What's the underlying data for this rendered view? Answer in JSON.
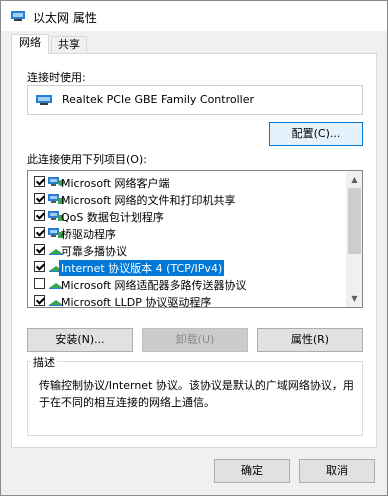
{
  "window": {
    "title": "以太网 属性"
  },
  "tabs": [
    {
      "label": "网络"
    },
    {
      "label": "共享"
    }
  ],
  "connect_using": {
    "label": "连接时使用:",
    "adapter": "Realtek PCIe GBE Family Controller",
    "configure_button": "配置(C)..."
  },
  "items_section": {
    "label": "此连接使用下列项目(O):",
    "items": [
      {
        "label": "Microsoft 网络客户端",
        "checked": true,
        "icon": "network-client-icon"
      },
      {
        "label": "Microsoft 网络的文件和打印机共享",
        "checked": true,
        "icon": "network-service-icon"
      },
      {
        "label": "QoS 数据包计划程序",
        "checked": true,
        "icon": "network-service-icon"
      },
      {
        "label": "桥驱动程序",
        "checked": true,
        "icon": "protocol-icon"
      },
      {
        "label": "可靠多播协议",
        "checked": true,
        "icon": "protocol-icon"
      },
      {
        "label": "Internet 协议版本 4 (TCP/IPv4)",
        "checked": true,
        "icon": "protocol-icon",
        "selected": true
      },
      {
        "label": "Microsoft 网络适配器多路传送器协议",
        "checked": false,
        "icon": "protocol-icon"
      },
      {
        "label": "Microsoft LLDP 协议驱动程序",
        "checked": true,
        "icon": "protocol-icon"
      }
    ],
    "install_button": "安装(N)...",
    "uninstall_button": "卸载(U)",
    "properties_button": "属性(R)"
  },
  "description": {
    "title": "描述",
    "text": "传输控制协议/Internet 协议。该协议是默认的广域网络协议，用于在不同的相互连接的网络上通信。"
  },
  "footer": {
    "ok_button": "确定",
    "cancel_button": "取消"
  },
  "colors": {
    "accent": "#0078d7",
    "window_bg": "#f0f0f0"
  }
}
